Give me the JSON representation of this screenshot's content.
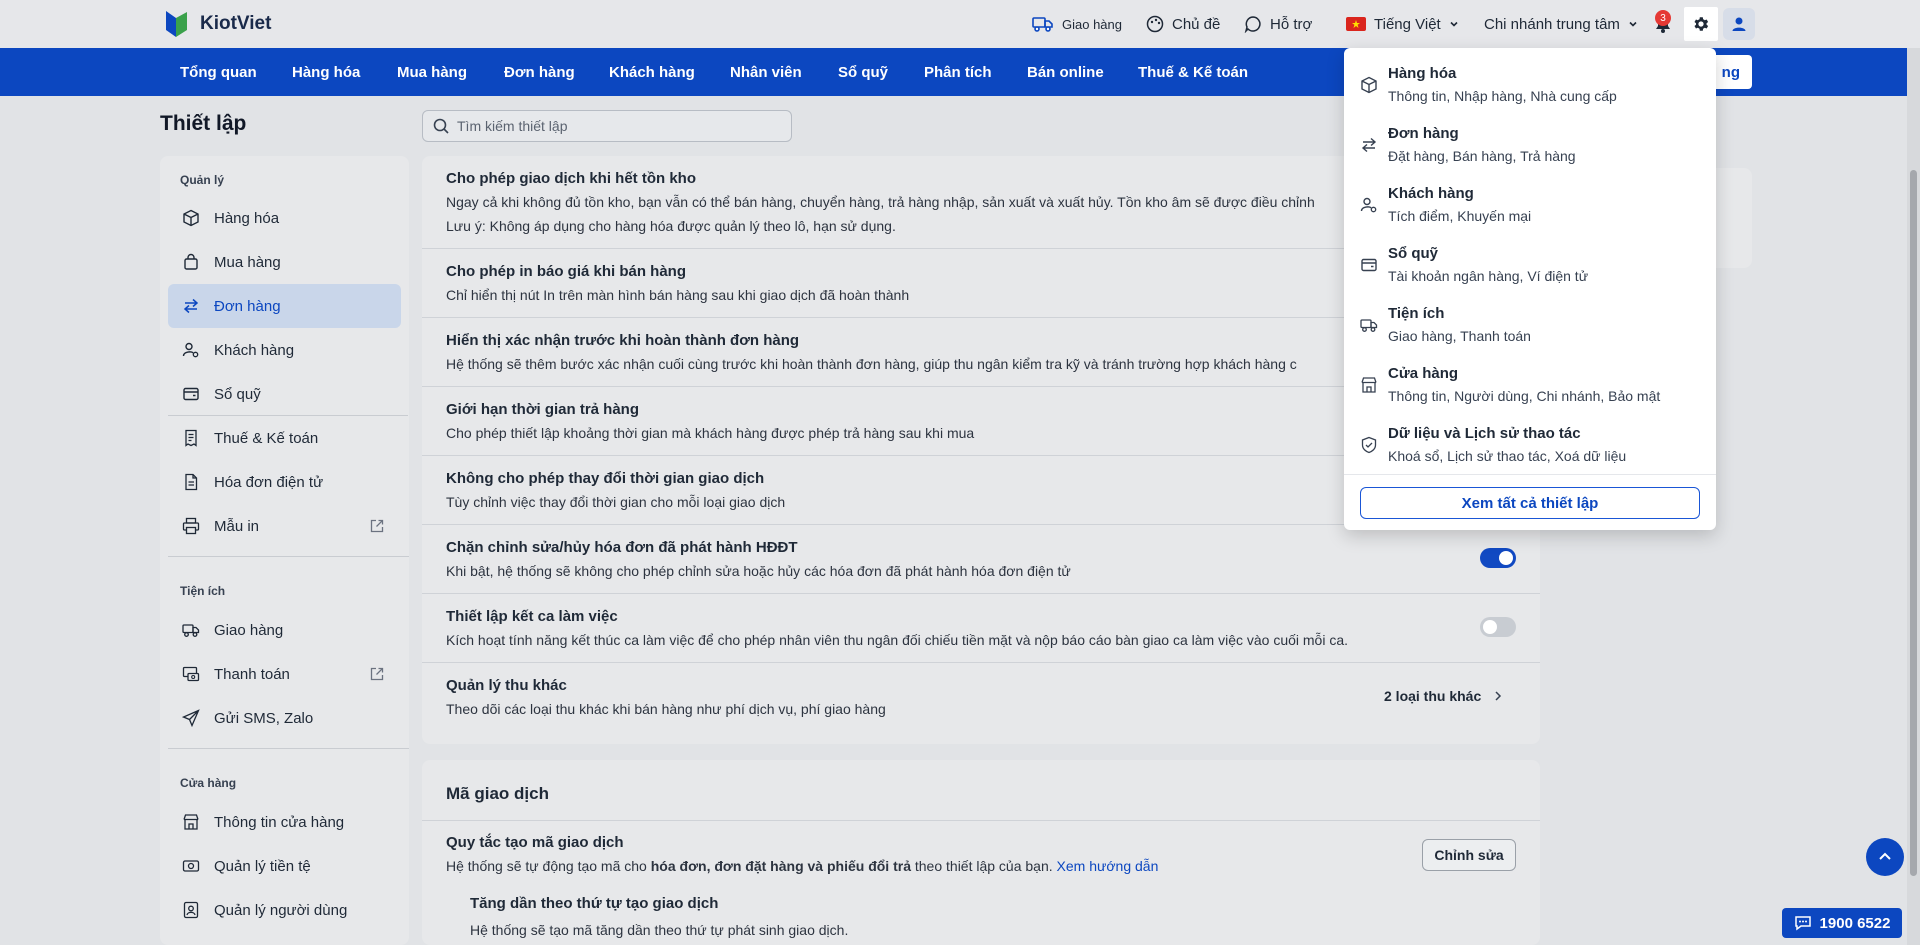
{
  "app": {
    "logo_text": "KiotViet"
  },
  "topbar": {
    "delivery": "Giao hàng",
    "theme": "Chủ đề",
    "support": "Hỗ trợ",
    "language": "Tiếng Việt",
    "branch": "Chi nhánh trung tâm",
    "notification_count": "3"
  },
  "nav": {
    "items": [
      "Tổng quan",
      "Hàng hóa",
      "Mua hàng",
      "Đơn hàng",
      "Khách hàng",
      "Nhân viên",
      "Sổ quỹ",
      "Phân tích",
      "Bán online",
      "Thuế & Kế toán"
    ],
    "right_button_fragment": "ng"
  },
  "page": {
    "title": "Thiết lập",
    "search_placeholder": "Tìm kiếm thiết lập"
  },
  "sidebar": {
    "sections": [
      {
        "label": "Quản lý",
        "items": [
          {
            "label": "Hàng hóa",
            "icon": "box-icon"
          },
          {
            "label": "Mua hàng",
            "icon": "bag-icon"
          },
          {
            "label": "Đơn hàng",
            "icon": "swap-icon",
            "active": true
          },
          {
            "label": "Khách hàng",
            "icon": "user-gear-icon"
          },
          {
            "label": "Sổ quỹ",
            "icon": "wallet-icon"
          },
          {
            "label": "Thuế & Kế toán",
            "icon": "receipt-icon"
          },
          {
            "label": "Hóa đơn điện tử",
            "icon": "document-icon"
          },
          {
            "label": "Mẫu in",
            "icon": "printer-icon",
            "external": true
          }
        ]
      },
      {
        "label": "Tiện ích",
        "items": [
          {
            "label": "Giao hàng",
            "icon": "truck-icon"
          },
          {
            "label": "Thanh toán",
            "icon": "payment-icon",
            "external": true
          },
          {
            "label": "Gửi SMS, Zalo",
            "icon": "send-icon"
          }
        ]
      },
      {
        "label": "Cửa hàng",
        "items": [
          {
            "label": "Thông tin cửa hàng",
            "icon": "store-icon"
          },
          {
            "label": "Quản lý tiền tệ",
            "icon": "money-icon"
          },
          {
            "label": "Quản lý người dùng",
            "icon": "user-badge-icon"
          }
        ]
      }
    ]
  },
  "settings": {
    "rows": [
      {
        "title": "Cho phép giao dịch khi hết tồn kho",
        "desc": "Ngay cả khi không đủ tồn kho, bạn vẫn có thể bán hàng, chuyển hàng, trả hàng nhập, sản xuất và xuất hủy. Tồn kho âm sẽ được điều chỉnh",
        "desc2": "Lưu ý: Không áp dụng cho hàng hóa được quản lý theo lô, hạn sử dụng."
      },
      {
        "title": "Cho phép in báo giá khi bán hàng",
        "desc": "Chỉ hiển thị nút In trên màn hình bán hàng sau khi giao dịch đã hoàn thành"
      },
      {
        "title": "Hiển thị xác nhận trước khi hoàn thành đơn hàng",
        "desc": "Hệ thống sẽ thêm bước xác nhận cuối cùng trước khi hoàn thành đơn hàng, giúp thu ngân kiểm tra kỹ và tránh trường hợp khách hàng c"
      },
      {
        "title": "Giới hạn thời gian trả hàng",
        "desc": "Cho phép thiết lập khoảng thời gian mà khách hàng được phép trả hàng sau khi mua"
      },
      {
        "title": "Không cho phép thay đổi thời gian giao dịch",
        "desc": "Tùy chỉnh việc thay đổi thời gian cho mỗi loại giao dịch"
      },
      {
        "title": "Chặn chỉnh sửa/hủy hóa đơn đã phát hành HĐĐT",
        "desc": "Khi bật, hệ thống sẽ không cho phép chỉnh sửa hoặc hủy các hóa đơn đã phát hành hóa đơn điện tử",
        "toggle": true
      },
      {
        "title": "Thiết lập kết ca làm việc",
        "desc": "Kích hoạt tính năng kết thúc ca làm việc để cho phép nhân viên thu ngân đối chiếu tiền mặt và nộp báo cáo bàn giao ca làm việc vào cuối mỗi ca.",
        "toggle": false
      },
      {
        "title": "Quản lý thu khác",
        "desc": "Theo dõi các loại thu khác khi bán hàng như phí dịch vụ, phí giao hàng",
        "link": "2 loại thu khác"
      }
    ]
  },
  "transaction_code": {
    "heading": "Mã giao dịch",
    "rule_title": "Quy tắc tạo mã giao dịch",
    "rule_desc_pre": "Hệ thống sẽ tự động tạo mã cho ",
    "rule_desc_bold": "hóa đơn, đơn đặt hàng và phiếu đổi trả",
    "rule_desc_post": " theo thiết lập của bạn. ",
    "guide_link": "Xem hướng dẫn",
    "edit_button": "Chỉnh sửa",
    "sub_title": "Tăng dần theo thứ tự tạo giao dịch",
    "sub_desc": "Hệ thống sẽ tạo mã tăng dần theo thứ tự phát sinh giao dịch."
  },
  "dropdown": {
    "items": [
      {
        "title": "Hàng hóa",
        "sub": "Thông tin, Nhập hàng, Nhà cung cấp",
        "icon": "box-icon"
      },
      {
        "title": "Đơn hàng",
        "sub": "Đặt hàng, Bán hàng, Trả hàng",
        "icon": "swap-icon"
      },
      {
        "title": "Khách hàng",
        "sub": "Tích điểm, Khuyến mại",
        "icon": "user-gear-icon"
      },
      {
        "title": "Sổ quỹ",
        "sub": "Tài khoản ngân hàng, Ví điện tử",
        "icon": "wallet-icon"
      },
      {
        "title": "Tiện ích",
        "sub": "Giao hàng, Thanh toán",
        "icon": "truck-icon"
      },
      {
        "title": "Cửa hàng",
        "sub": "Thông tin, Người dùng, Chi nhánh, Bảo mật",
        "icon": "store-icon"
      },
      {
        "title": "Dữ liệu và Lịch sử thao tác",
        "sub": "Khoá sổ, Lịch sử thao tác, Xoá dữ liệu",
        "icon": "shield-icon"
      }
    ],
    "view_all": "Xem tất cả thiết lập"
  },
  "hotline": "1900 6522",
  "colors": {
    "brand": "#0c47c0",
    "accent": "#1149c2",
    "badge": "#e53935"
  }
}
